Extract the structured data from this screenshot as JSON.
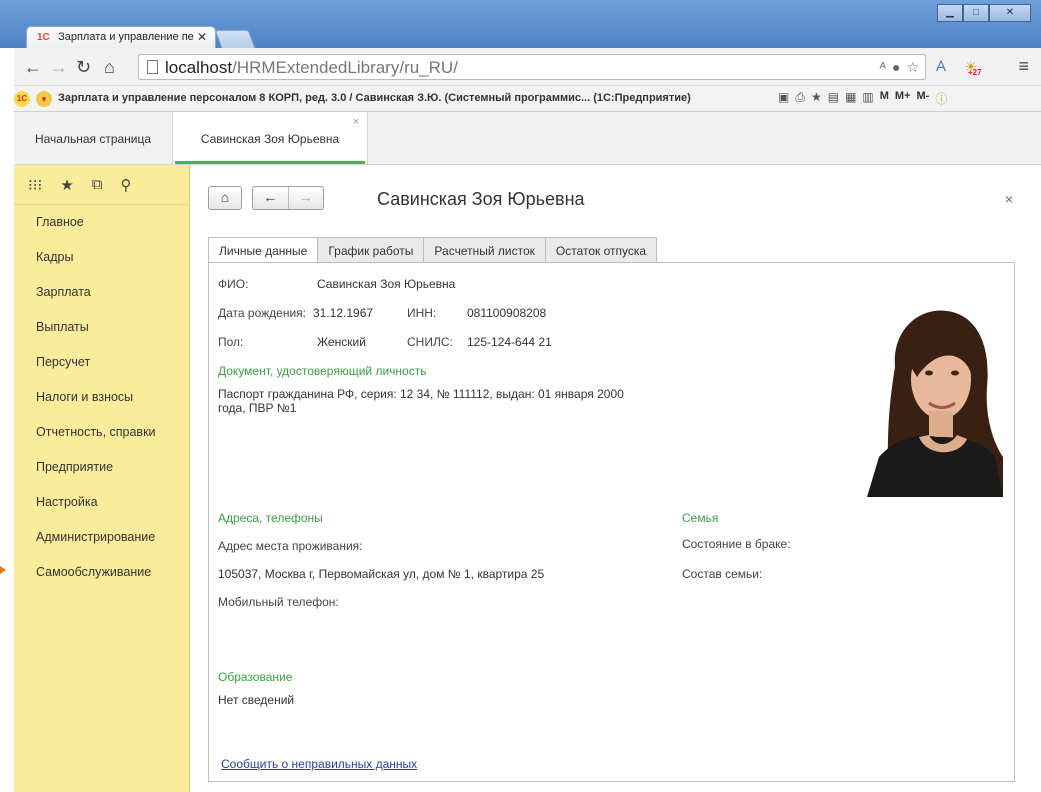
{
  "browser": {
    "tab_title": "Зарплата и управление пе",
    "favicon": "1С",
    "url_host": "localhost",
    "url_path": "/HRMExtendedLibrary/ru_RU/",
    "ext_badge": "+27"
  },
  "appbar": {
    "title": "Зарплата и управление персоналом 8 КОРП, ред. 3.0 / Савинская З.Ю. (Системный программис... (1С:Предприятие)",
    "m1": "M",
    "m2": "M+",
    "m3": "M-"
  },
  "windows": {
    "home": "Начальная страница",
    "current": "Савинская Зоя Юрьевна"
  },
  "sidebar": {
    "items": [
      {
        "label": "Главное"
      },
      {
        "label": "Кадры"
      },
      {
        "label": "Зарплата"
      },
      {
        "label": "Выплаты"
      },
      {
        "label": "Персучет"
      },
      {
        "label": "Налоги и взносы"
      },
      {
        "label": "Отчетность, справки"
      },
      {
        "label": "Предприятие"
      },
      {
        "label": "Настройка"
      },
      {
        "label": "Администрирование"
      },
      {
        "label": "Самообслуживание"
      }
    ]
  },
  "form": {
    "title": "Савинская Зоя Юрьевна",
    "tabs": [
      "Личные данные",
      "График работы",
      "Расчетный листок",
      "Остаток отпуска"
    ],
    "fio_label": "ФИО:",
    "fio": "Савинская Зоя Юрьевна",
    "birth_label": "Дата рождения:",
    "birth": "31.12.1967",
    "inn_label": "ИНН:",
    "inn": "081100908208",
    "sex_label": "Пол:",
    "sex": "Женский",
    "snils_label": "СНИЛС:",
    "snils": "125-124-644 21",
    "doc_group": "Документ, удостоверяющий личность",
    "doc_line1": "Паспорт гражданина РФ, серия: 12 34, № 111112, выдан: 01 января 2000",
    "doc_line2": "года, ПВР №1",
    "addr_group": "Адреса, телефоны",
    "addr_label": "Адрес места проживания:",
    "addr": "105037, Москва г, Первомайская ул, дом № 1, квартира 25",
    "mobile_label": "Мобильный телефон:",
    "family_group": "Семья",
    "marital_label": "Состояние в браке:",
    "family_label": "Состав семьи:",
    "edu_group": "Образование",
    "edu": "Нет сведений",
    "report_link": "Сообщить о неправильных данных"
  }
}
